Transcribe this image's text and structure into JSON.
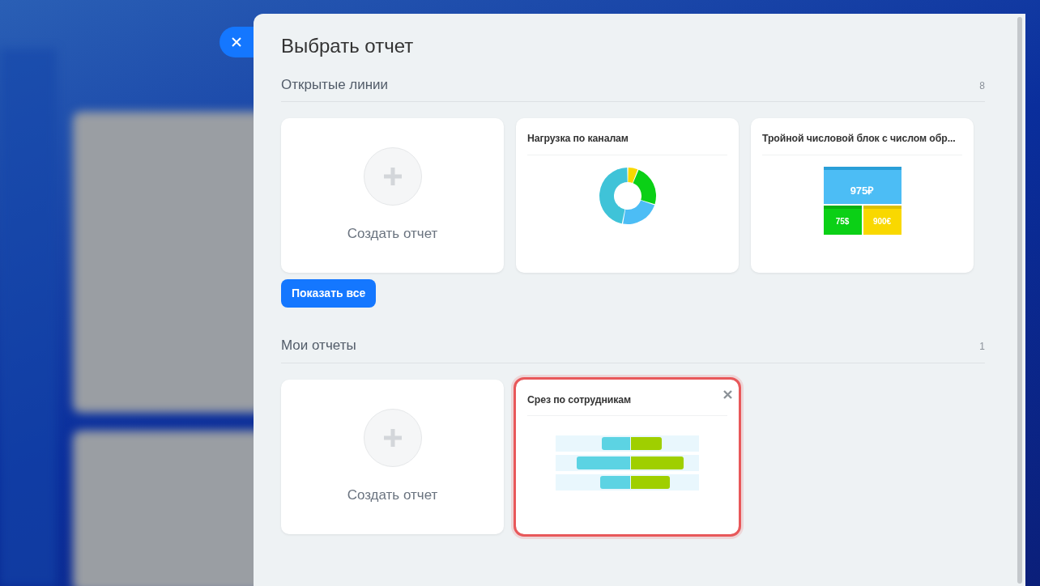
{
  "title": "Выбрать отчет",
  "sections": [
    {
      "title": "Открытые линии",
      "count": "8",
      "show_all": "Показать все",
      "cards": [
        {
          "kind": "create",
          "label": "Создать отчет",
          "selected": false
        },
        {
          "kind": "donut",
          "title": "Нагрузка по каналам",
          "selected": false
        },
        {
          "kind": "triple",
          "title": "Тройной числовой блок с числом обр...",
          "values": [
            "975₽",
            "75$",
            "900€"
          ],
          "selected": false
        }
      ]
    },
    {
      "title": "Мои отчеты",
      "count": "1",
      "cards": [
        {
          "kind": "create",
          "label": "Создать отчет",
          "selected": false
        },
        {
          "kind": "bars",
          "title": "Срез по сотрудникам",
          "selected": true
        }
      ]
    }
  ]
}
